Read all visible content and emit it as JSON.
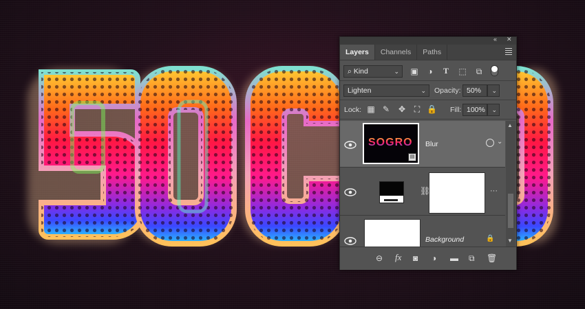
{
  "artwork": {
    "letters": [
      "5",
      "O",
      "G",
      "O"
    ]
  },
  "panel": {
    "topbar": {
      "collapse_icon": "double-chevron-icon",
      "close_icon": "close-icon"
    },
    "tabs": [
      {
        "label": "Layers",
        "active": true
      },
      {
        "label": "Channels",
        "active": false
      },
      {
        "label": "Paths",
        "active": false
      }
    ],
    "filter": {
      "label": "Kind",
      "icons": [
        "image-filter-icon",
        "adjustment-filter-icon",
        "type-filter-icon",
        "shape-filter-icon",
        "smart-object-filter-icon"
      ]
    },
    "blend_mode": "Lighten",
    "opacity": {
      "label": "Opacity:",
      "value": "50%"
    },
    "lock": {
      "label": "Lock:",
      "icons": [
        "lock-transparent-icon",
        "lock-image-icon",
        "lock-position-icon",
        "lock-artboard-icon",
        "lock-all-icon"
      ]
    },
    "fill": {
      "label": "Fill:",
      "value": "100%"
    },
    "layers": [
      {
        "name": "Blur",
        "type": "smart-object",
        "selected": true,
        "thumb_text": "SOGRO"
      },
      {
        "name": "",
        "type": "adjustment-with-mask",
        "selected": false
      },
      {
        "name": "Background",
        "type": "background",
        "selected": false,
        "locked": true
      }
    ],
    "bottom_icons": [
      "link-layers-icon",
      "fx-icon",
      "add-mask-icon",
      "new-adjustment-icon",
      "new-group-icon",
      "new-layer-icon",
      "delete-layer-icon"
    ],
    "fx_label": "fx"
  }
}
